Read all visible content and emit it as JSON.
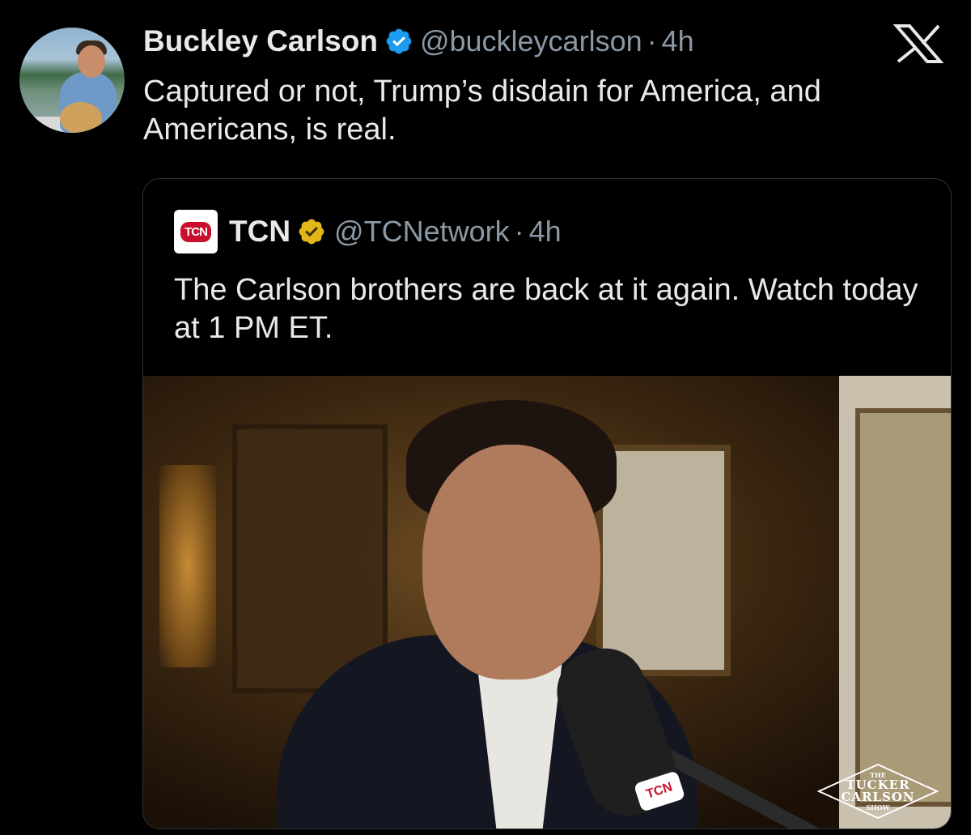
{
  "tweet": {
    "author_name": "Buckley Carlson",
    "author_handle": "@buckleycarlson",
    "separator": "·",
    "time": "4h",
    "text": "Captured or not, Trump’s disdain for America, and Americans, is real.",
    "platform_icon": "x-logo-icon",
    "verified_color": "#1d9bf0"
  },
  "quoted_tweet": {
    "avatar_text": "TCN",
    "author_name": "TCN",
    "author_handle": "@TCNetwork",
    "separator": "·",
    "time": "4h",
    "text": "The Carlson brothers are back at it again. Watch today at 1 PM ET.",
    "verified_color": "#e2b719",
    "brand_color": "#c8102e",
    "media": {
      "mic_flag_text": "TCN",
      "watermark": {
        "the": "THE",
        "line1": "TUCKER",
        "line2": "CARLSON",
        "show": "SHOW"
      }
    }
  }
}
